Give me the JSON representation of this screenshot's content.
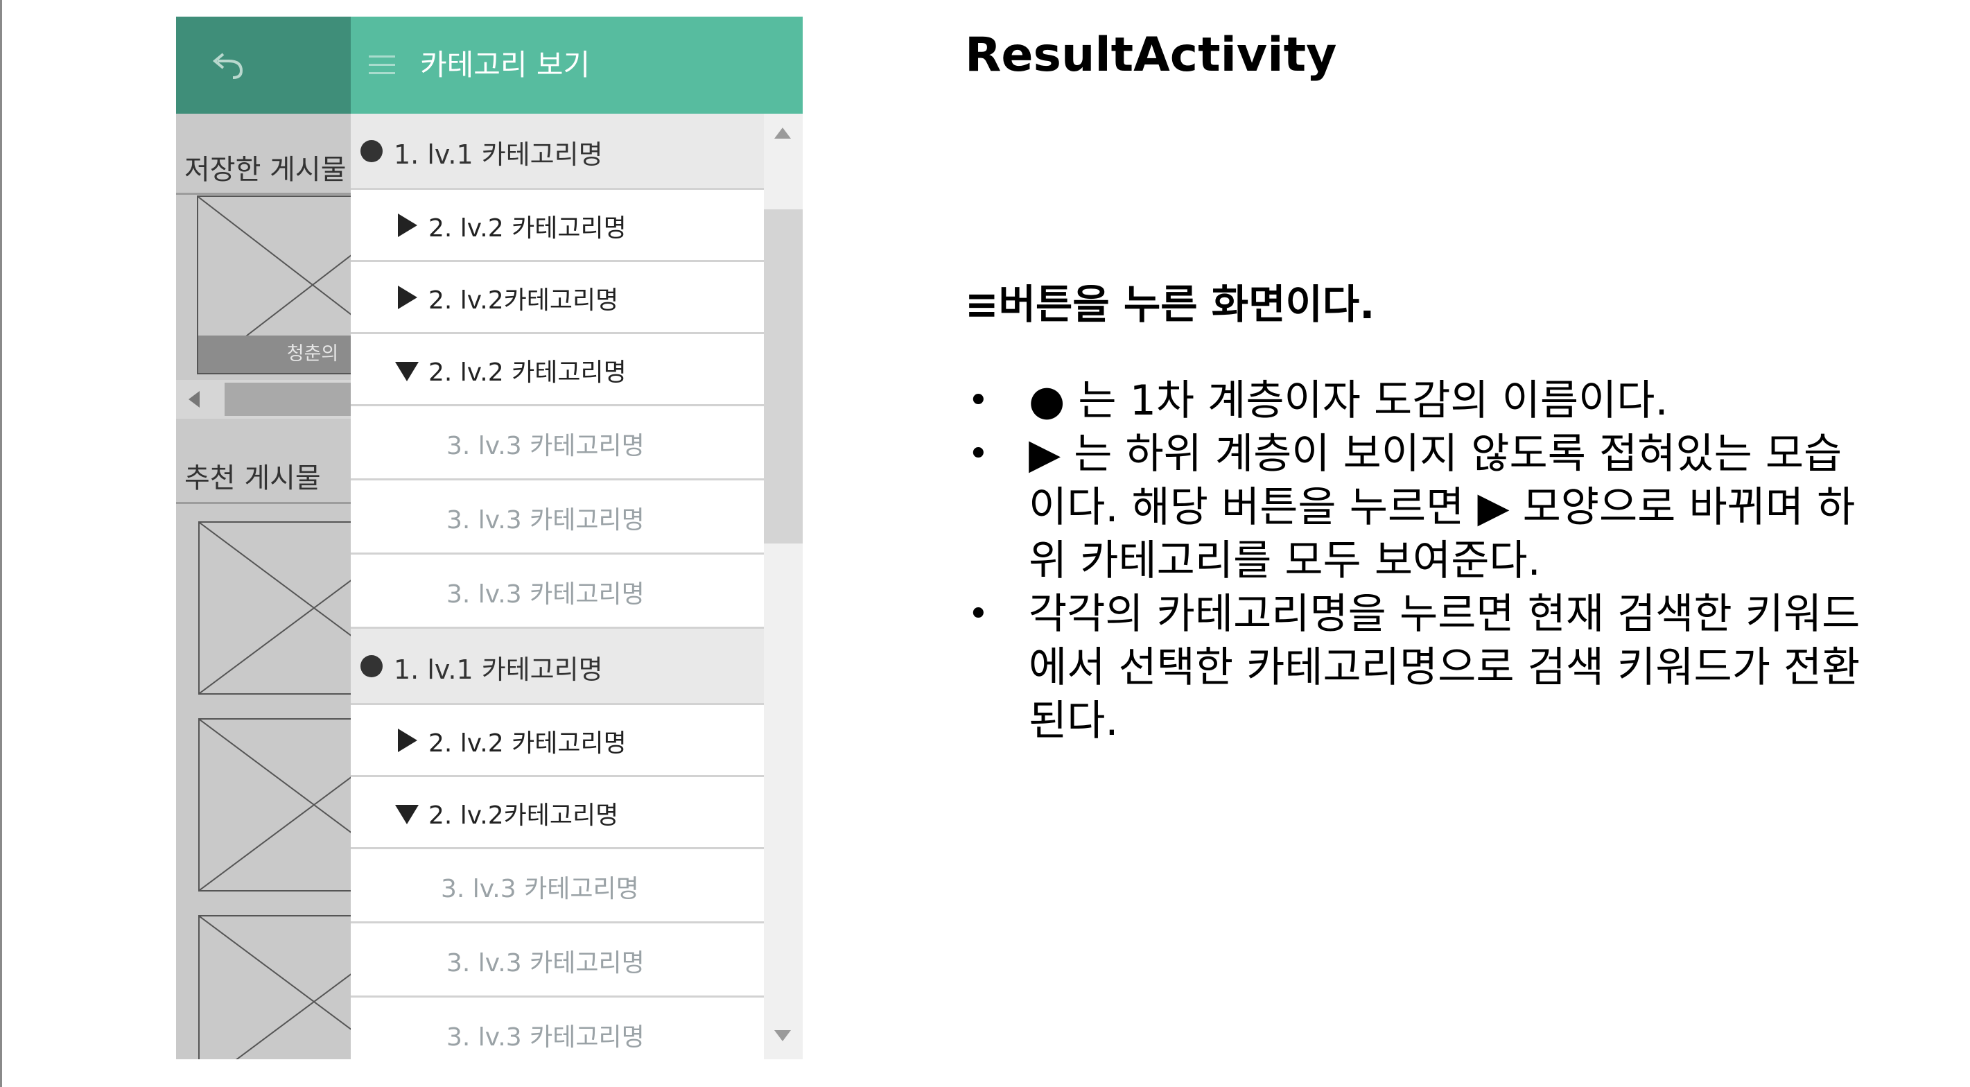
{
  "background_screen": {
    "saved_posts_label": "저장한 게시물",
    "saved_thumb_caption": "청춘의",
    "recommended_label": "추천 게시물"
  },
  "drawer": {
    "title": "카테고리 보기",
    "categories": [
      {
        "level": 1,
        "label": "1. lv.1 카테고리명"
      },
      {
        "level": 2,
        "state": "collapsed",
        "label": "2. lv.2 카테고리명"
      },
      {
        "level": 2,
        "state": "collapsed",
        "label": "2. lv.2카테고리명"
      },
      {
        "level": 2,
        "state": "expanded",
        "label": "2. lv.2 카테고리명"
      },
      {
        "level": 3,
        "label": "3. lv.3 카테고리명"
      },
      {
        "level": 3,
        "label": "3. lv.3 카테고리명"
      },
      {
        "level": 3,
        "label": "3. lv.3 카테고리명"
      },
      {
        "level": 1,
        "label": "1. lv.1 카테고리명"
      },
      {
        "level": 2,
        "state": "collapsed",
        "label": "2. lv.2 카테고리명"
      },
      {
        "level": 2,
        "state": "expanded",
        "label": "2. lv.2카테고리명"
      },
      {
        "level": 3,
        "label": "3. lv.3 카테고리명"
      },
      {
        "level": 3,
        "label": "3. lv.3 카테고리명"
      },
      {
        "level": 3,
        "label": "3. lv.3 카테고리명"
      }
    ]
  },
  "description": {
    "title": "ResultActivity",
    "subtitle": "≡버튼을 누른 화면이다.",
    "bullets": [
      "● 는 1차 계층이자 도감의 이름이다.",
      "▶ 는 하위 계층이 보이지 않도록 접혀있는 모습이다. 해당 버튼을 누르면 ▶ 모양으로 바뀌며 하위 카테고리를 모두 보여준다.",
      "각각의 카테고리명을 누르면 현재 검색한 키워드에서 선택한 카테고리명으로 검색 키워드가 전환된다."
    ]
  },
  "colors": {
    "drawer_header": "#57bc9f",
    "underlying_header": "#3f8e79",
    "lv1_row": "#e9e9e9",
    "lv3_text": "#9aa2a6"
  },
  "icons": [
    "back-arrow-icon",
    "hamburger-menu-icon",
    "bullet-icon",
    "triangle-right-icon",
    "triangle-down-icon",
    "scroll-up-arrow-icon",
    "scroll-down-arrow-icon",
    "image-placeholder-icon"
  ]
}
